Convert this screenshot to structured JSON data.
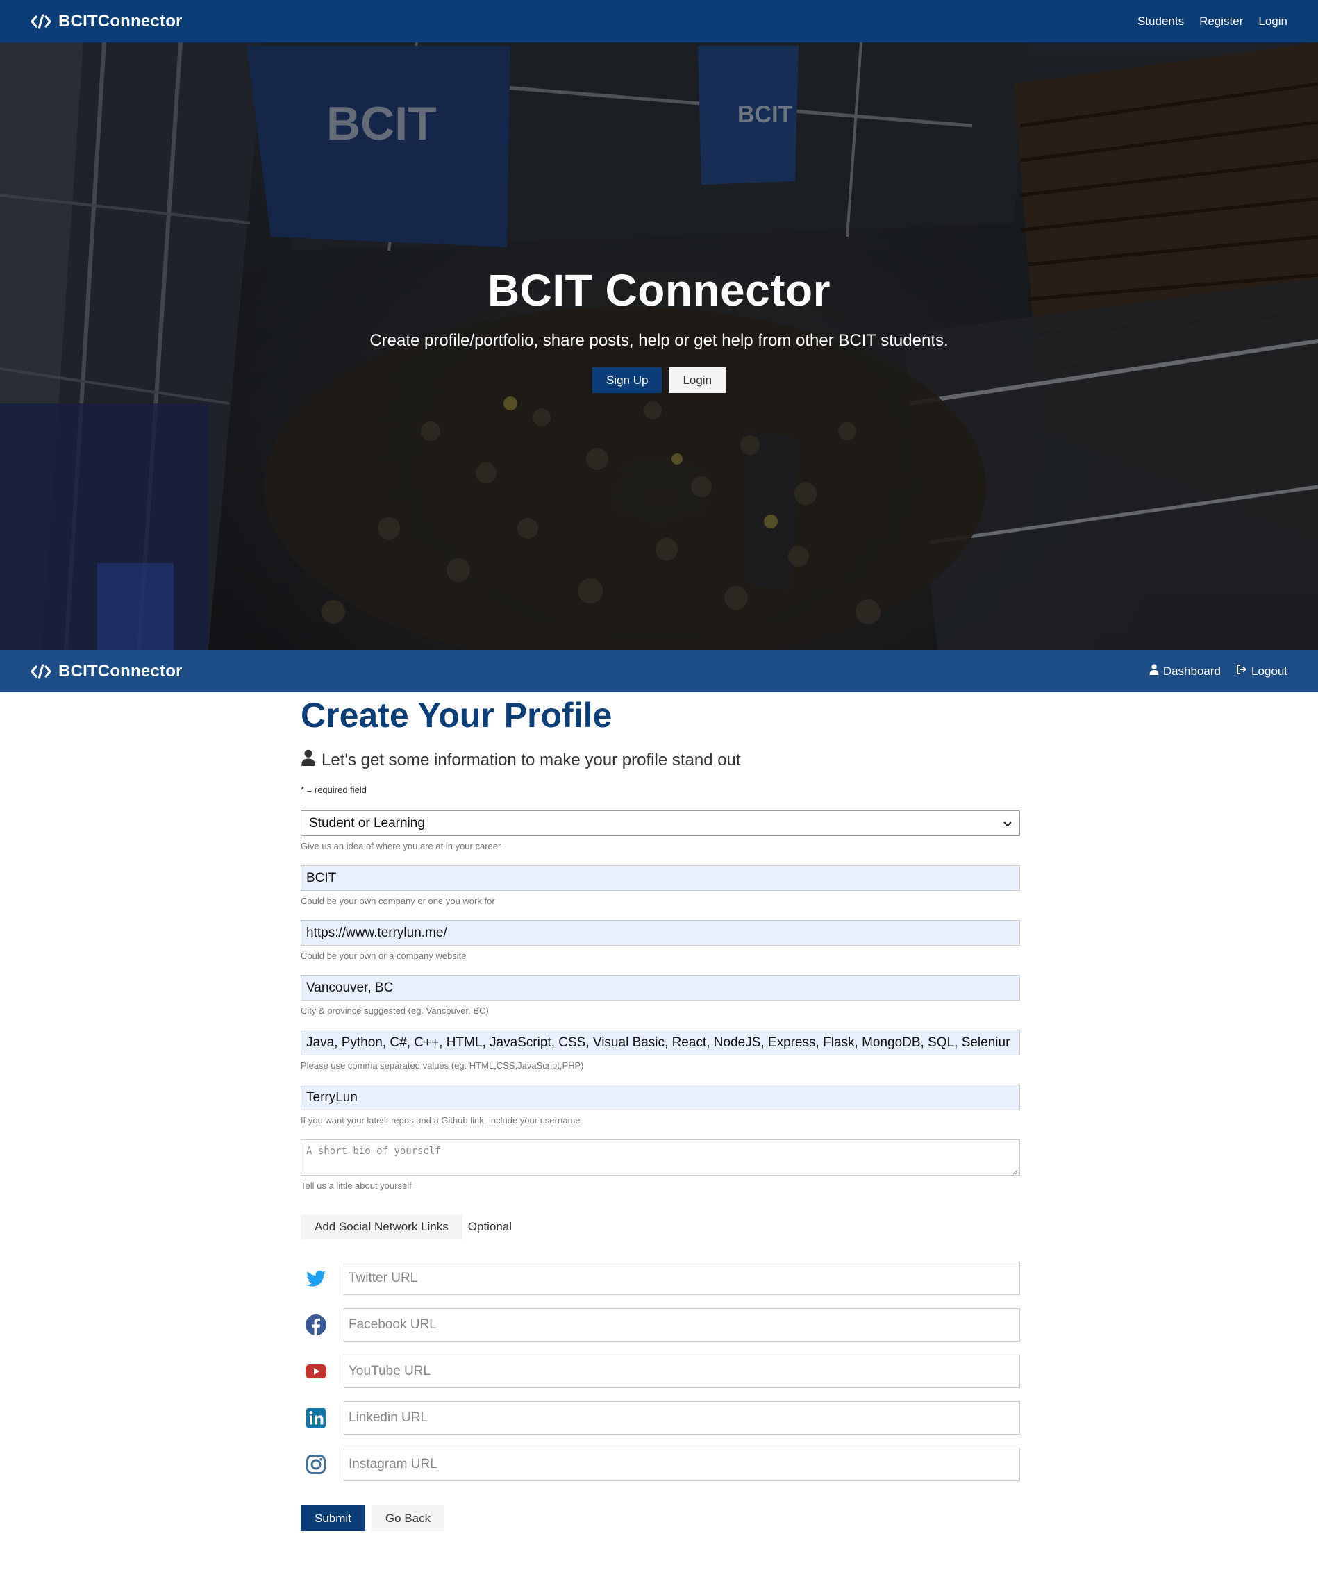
{
  "brand": {
    "name": "BCITConnector",
    "icon": "code-icon"
  },
  "top_nav": {
    "links": [
      "Students",
      "Register",
      "Login"
    ]
  },
  "hero": {
    "title": "BCIT Connector",
    "subtitle": "Create profile/portfolio, share posts, help or get help from other BCIT students.",
    "signup_label": "Sign Up",
    "login_label": "Login",
    "banner_text": "BCIT"
  },
  "dash_nav": {
    "dashboard_label": "Dashboard",
    "dashboard_icon": "user-icon",
    "logout_label": "Logout",
    "logout_icon": "sign-out-icon"
  },
  "profile_form": {
    "title": "Create Your Profile",
    "lead": "Let's get some information to make your profile stand out",
    "required_note": "* = required field",
    "status": {
      "value": "Student or Learning",
      "hint": "Give us an idea of where you are at in your career"
    },
    "company": {
      "value": "BCIT",
      "hint": "Could be your own company or one you work for"
    },
    "website": {
      "value": "https://www.terrylun.me/",
      "hint": "Could be your own or a company website"
    },
    "location": {
      "value": "Vancouver, BC",
      "hint": "City & province suggested (eg. Vancouver, BC)"
    },
    "skills": {
      "value": "Java, Python, C#, C++, HTML, JavaScript, CSS, Visual Basic, React, NodeJS, Express, Flask, MongoDB, SQL, Seleniur",
      "hint": "Please use comma separated values (eg. HTML,CSS,JavaScript,PHP)"
    },
    "github": {
      "value": "TerryLun",
      "hint": "If you want your latest repos and a Github link, include your username"
    },
    "bio": {
      "placeholder": "A short bio of yourself",
      "hint": "Tell us a little about yourself"
    },
    "social_toggle_label": "Add Social Network Links",
    "optional_label": "Optional",
    "social": [
      {
        "icon": "twitter-icon",
        "placeholder": "Twitter URL",
        "color": "#1da1f2"
      },
      {
        "icon": "facebook-icon",
        "placeholder": "Facebook URL",
        "color": "#3b5998"
      },
      {
        "icon": "youtube-icon",
        "placeholder": "YouTube URL",
        "color": "#c4302b"
      },
      {
        "icon": "linkedin-icon",
        "placeholder": "Linkedin URL",
        "color": "#0e76a8"
      },
      {
        "icon": "instagram-icon",
        "placeholder": "Instagram URL",
        "color": "#3f729b"
      }
    ],
    "submit_label": "Submit",
    "back_label": "Go Back"
  },
  "colors": {
    "primary": "#0a3e78",
    "navbar_secondary": "#1c4d86",
    "autofill": "#e8f0fe"
  }
}
